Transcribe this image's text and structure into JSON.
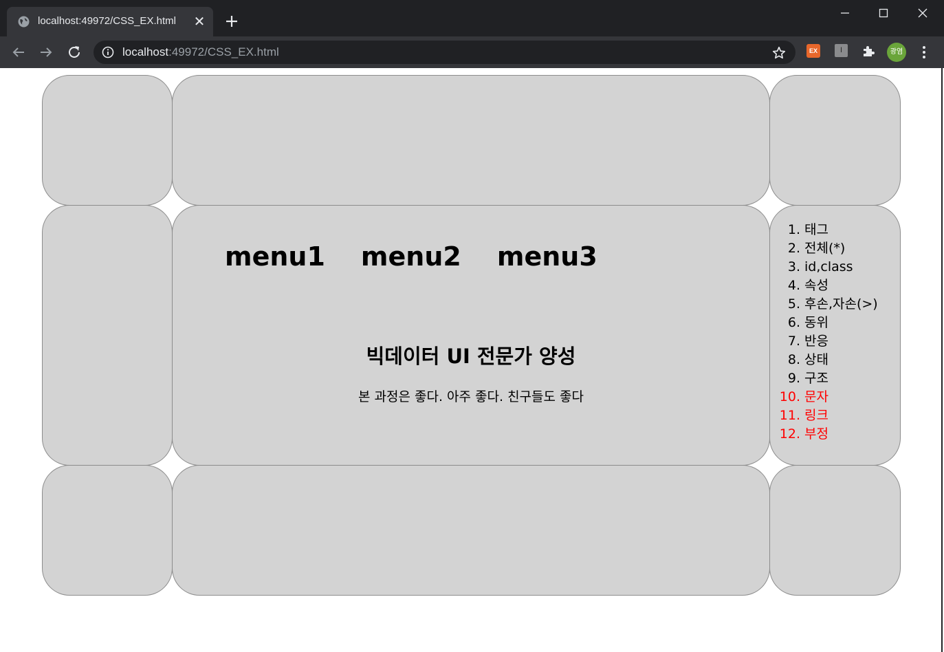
{
  "browser": {
    "tab_title": "localhost:49972/CSS_EX.html",
    "url_host": "localhost",
    "url_path": ":49972/CSS_EX.html",
    "extensions": {
      "ex_label": "EX",
      "i_label": "I"
    },
    "profile_label": "광염"
  },
  "page": {
    "menus": [
      "menu1",
      "menu2",
      "menu3"
    ],
    "title": "빅데이터 UI 전문가 양성",
    "description": "본 과정은 좋다. 아주 좋다. 친구들도 좋다",
    "toc": [
      {
        "num": "1.",
        "label": "태그",
        "color": "#000000"
      },
      {
        "num": "2.",
        "label": "전체(*)",
        "color": "#000000"
      },
      {
        "num": "3.",
        "label": "id,class",
        "color": "#000000"
      },
      {
        "num": "4.",
        "label": "속성",
        "color": "#000000"
      },
      {
        "num": "5.",
        "label": "후손,자손(>)",
        "color": "#000000"
      },
      {
        "num": "6.",
        "label": "동위",
        "color": "#000000"
      },
      {
        "num": "7.",
        "label": "반응",
        "color": "#000000"
      },
      {
        "num": "8.",
        "label": "상태",
        "color": "#000000"
      },
      {
        "num": "9.",
        "label": "구조",
        "color": "#000000"
      },
      {
        "num": "10.",
        "label": "문자",
        "color": "#ff0000"
      },
      {
        "num": "11.",
        "label": "링크",
        "color": "#ff0000"
      },
      {
        "num": "12.",
        "label": "부정",
        "color": "#ff0000"
      }
    ],
    "cell_color": "#d3d3d3"
  }
}
